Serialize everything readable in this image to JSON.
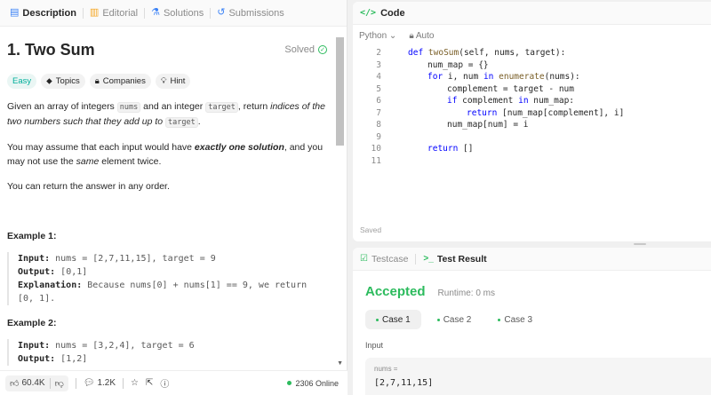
{
  "tabs": [
    {
      "label": "Description",
      "icon": "document-icon"
    },
    {
      "label": "Editorial",
      "icon": "book-icon"
    },
    {
      "label": "Solutions",
      "icon": "flask-icon"
    },
    {
      "label": "Submissions",
      "icon": "history-icon"
    }
  ],
  "problem": {
    "title": "1. Two Sum",
    "status": "Solved",
    "chips": {
      "difficulty": "Easy",
      "topics": "Topics",
      "companies": "Companies",
      "hint": "Hint"
    },
    "p1": {
      "a": "Given an array of integers ",
      "b": "nums",
      "c": " and an integer ",
      "d": "target",
      "e": ", return ",
      "f": "indices of the two numbers such that they add up to ",
      "g": "target",
      "h": "."
    },
    "p2": {
      "a": "You may assume that each input would have ",
      "b": "exactly one solution",
      "c": ", and you may not use the ",
      "d": "same",
      "e": " element twice."
    },
    "p3": "You can return the answer in any order.",
    "examples": [
      {
        "title": "Example 1:",
        "input_label": "Input:",
        "input": " nums = [2,7,11,15], target = 9",
        "output_label": "Output:",
        "output": " [0,1]",
        "expl_label": "Explanation:",
        "expl": " Because nums[0] + nums[1] == 9, we return [0, 1]."
      },
      {
        "title": "Example 2:",
        "input_label": "Input:",
        "input": " nums = [3,2,4], target = 6",
        "output_label": "Output:",
        "output": " [1,2]"
      }
    ]
  },
  "bottom": {
    "likes": "60.4K",
    "comments": "1.2K",
    "online": "2306 Online"
  },
  "code": {
    "title": "Code",
    "tag": "</>",
    "language": "Python",
    "mode": "Auto",
    "saved": "Saved",
    "lines": [
      {
        "n": "2",
        "t": "def twoSum(self, nums, target):",
        "indent": 0
      },
      {
        "n": "3",
        "t": "num_map = {}",
        "indent": 1
      },
      {
        "n": "4",
        "t": "for i, num in enumerate(nums):",
        "indent": 1
      },
      {
        "n": "5",
        "t": "complement = target - num",
        "indent": 2
      },
      {
        "n": "6",
        "t": "if complement in num_map:",
        "indent": 2
      },
      {
        "n": "7",
        "t": "return [num_map[complement], i]",
        "indent": 3
      },
      {
        "n": "8",
        "t": "num_map[num] = i",
        "indent": 2
      },
      {
        "n": "9",
        "t": "",
        "indent": 0
      },
      {
        "n": "10",
        "t": "return []",
        "indent": 1
      },
      {
        "n": "11",
        "t": "",
        "indent": 0
      }
    ]
  },
  "test": {
    "tab_testcase": "Testcase",
    "tab_result": "Test Result",
    "verdict": "Accepted",
    "runtime": "Runtime: 0 ms",
    "cases": [
      "Case 1",
      "Case 2",
      "Case 3"
    ],
    "input_label": "Input",
    "var_name": "nums =",
    "var_value": "[2,7,11,15]"
  },
  "colors": {
    "accent_green": "#2cbb5d",
    "easy": "#00af9b"
  }
}
